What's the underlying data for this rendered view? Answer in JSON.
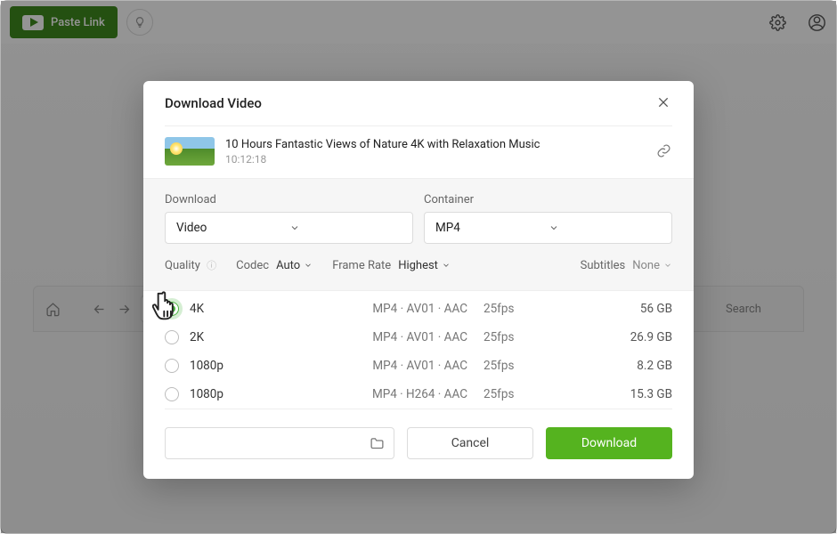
{
  "topbar": {
    "paste_link": "Paste Link"
  },
  "browser": {
    "search_label": "Search"
  },
  "dialog": {
    "title": "Download Video",
    "video": {
      "title": "10 Hours Fantastic Views of Nature 4K with Relaxation Music",
      "duration": "10:12:18"
    },
    "download_label": "Download",
    "container_label": "Container",
    "download_select": "Video",
    "container_select": "MP4",
    "quality_label": "Quality",
    "codec_label": "Codec",
    "codec_value": "Auto",
    "framerate_label": "Frame Rate",
    "framerate_value": "Highest",
    "subtitles_label": "Subtitles",
    "subtitles_value": "None",
    "rows": [
      {
        "res": "4K",
        "fmt": "MP4 · AV01 · AAC",
        "fps": "25fps",
        "size": "56 GB"
      },
      {
        "res": "2K",
        "fmt": "MP4 · AV01 · AAC",
        "fps": "25fps",
        "size": "26.9 GB"
      },
      {
        "res": "1080p",
        "fmt": "MP4 · AV01 · AAC",
        "fps": "25fps",
        "size": "8.2 GB"
      },
      {
        "res": "1080p",
        "fmt": "MP4 · H264 · AAC",
        "fps": "25fps",
        "size": "15.3 GB"
      }
    ],
    "cancel_label": "Cancel",
    "confirm_label": "Download"
  }
}
